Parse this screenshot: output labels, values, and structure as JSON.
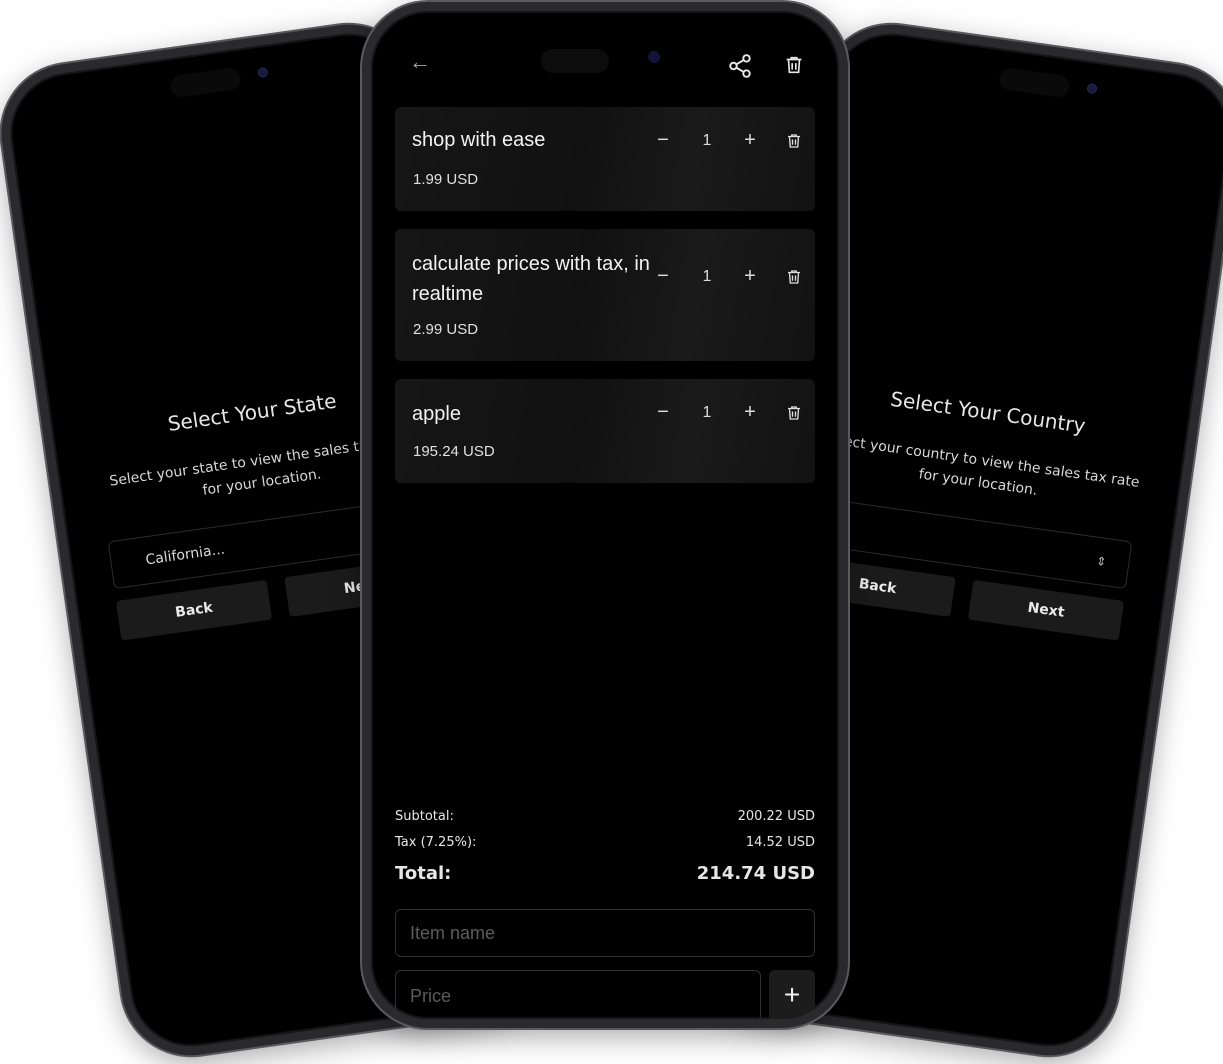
{
  "left_screen": {
    "title": "Select Your State",
    "description": "Select your state to view the sales tax rate for your location.",
    "select_value": "California...",
    "back_label": "Back",
    "next_label": "Next"
  },
  "right_screen": {
    "title": "Select Your Country",
    "description": "Select your country to view the sales tax rate for your location.",
    "select_value": "",
    "back_label": "Back",
    "next_label": "Next"
  },
  "cart": {
    "back_icon": "arrow-left-icon",
    "share_icon": "share-icon",
    "delete_icon": "trash-icon",
    "items": [
      {
        "name": "shop with ease",
        "price": "1.99 USD",
        "qty": "1"
      },
      {
        "name": "calculate prices with tax, in realtime",
        "price": "2.99 USD",
        "qty": "1"
      },
      {
        "name": "apple",
        "price": "195.24 USD",
        "qty": "1"
      }
    ],
    "qty_minus": "−",
    "qty_plus": "+",
    "subtotal_label": "Subtotal:",
    "subtotal_value": "200.22 USD",
    "tax_label": "Tax (7.25%):",
    "tax_value": "14.52 USD",
    "total_label": "Total:",
    "total_value": "214.74 USD",
    "item_name_placeholder": "Item name",
    "price_placeholder": "Price",
    "add_label": "+"
  }
}
